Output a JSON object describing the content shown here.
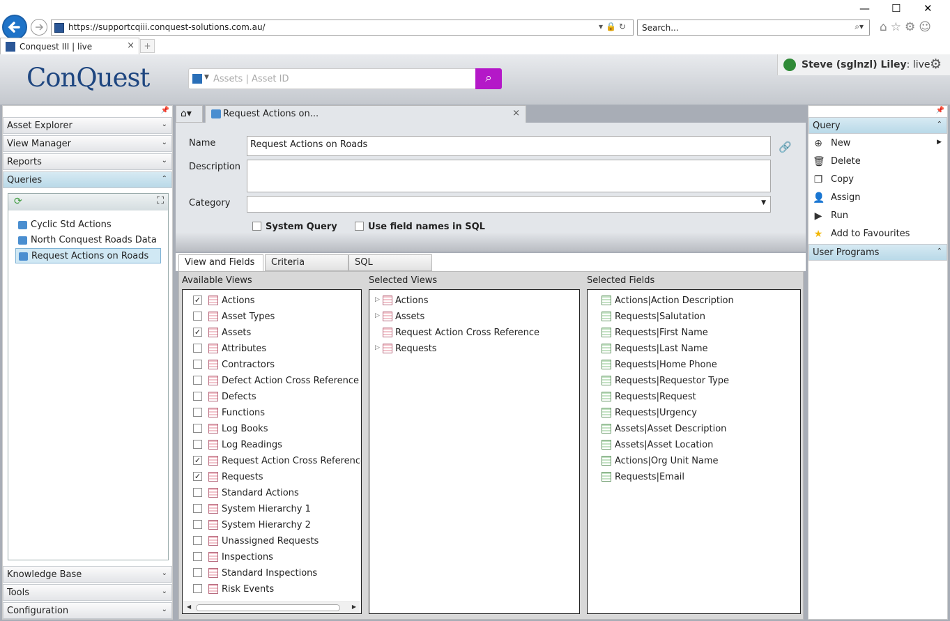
{
  "browser": {
    "url": "https://supportcqiii.conquest-solutions.com.au/",
    "search_placeholder": "Search...",
    "tab_title": "Conquest III | live"
  },
  "app": {
    "logo_text": "ConQuest",
    "search": {
      "scope": "Assets",
      "placeholder": "Assets  |  Asset ID"
    },
    "user": {
      "name": "Steve (sglnzl) Liley",
      "env": ": live"
    }
  },
  "left_panel": {
    "sections_top": [
      "Asset Explorer",
      "View Manager",
      "Reports",
      "Queries"
    ],
    "queries": [
      "Cyclic Std Actions",
      "North Conquest Roads Data",
      "Request Actions on Roads"
    ],
    "selected_query": "Request Actions on Roads",
    "sections_bottom": [
      "Knowledge Base",
      "Tools",
      "Configuration"
    ]
  },
  "main": {
    "doc_tab": "Request Actions on...",
    "form": {
      "name_label": "Name",
      "name_value": "Request Actions on Roads",
      "description_label": "Description",
      "description_value": "",
      "category_label": "Category",
      "category_value": "",
      "system_query_label": "System Query",
      "use_field_names_label": "Use field names in SQL"
    },
    "tabs": [
      "View and Fields",
      "Criteria",
      "SQL"
    ],
    "available_views_title": "Available Views",
    "available_views": [
      {
        "name": "Actions",
        "checked": true
      },
      {
        "name": "Asset Types",
        "checked": false
      },
      {
        "name": "Assets",
        "checked": true
      },
      {
        "name": "Attributes",
        "checked": false
      },
      {
        "name": "Contractors",
        "checked": false
      },
      {
        "name": "Defect Action Cross Reference",
        "checked": false
      },
      {
        "name": "Defects",
        "checked": false
      },
      {
        "name": "Functions",
        "checked": false
      },
      {
        "name": "Log Books",
        "checked": false
      },
      {
        "name": "Log Readings",
        "checked": false
      },
      {
        "name": "Request Action Cross Reference",
        "checked": true
      },
      {
        "name": "Requests",
        "checked": true
      },
      {
        "name": "Standard Actions",
        "checked": false
      },
      {
        "name": "System Hierarchy 1",
        "checked": false
      },
      {
        "name": "System Hierarchy 2",
        "checked": false
      },
      {
        "name": "Unassigned Requests",
        "checked": false
      },
      {
        "name": "Inspections",
        "checked": false
      },
      {
        "name": "Standard Inspections",
        "checked": false
      },
      {
        "name": "Risk Events",
        "checked": false
      }
    ],
    "selected_views_title": "Selected Views",
    "selected_views": [
      {
        "name": "Actions",
        "expandable": true
      },
      {
        "name": "Assets",
        "expandable": true
      },
      {
        "name": "Request Action Cross Reference",
        "expandable": false
      },
      {
        "name": "Requests",
        "expandable": true
      }
    ],
    "selected_fields_title": "Selected Fields",
    "selected_fields": [
      "Actions|Action Description",
      "Requests|Salutation",
      "Requests|First Name",
      "Requests|Last Name",
      "Requests|Home Phone",
      "Requests|Requestor Type",
      "Requests|Request",
      "Requests|Urgency",
      "Assets|Asset Description",
      "Assets|Asset Location",
      "Actions|Org Unit Name",
      "Requests|Email"
    ]
  },
  "right_panel": {
    "query_section": "Query",
    "actions": [
      {
        "label": "New",
        "icon": "plus-circle-icon",
        "glyph": "⊕",
        "submenu": true
      },
      {
        "label": "Delete",
        "icon": "trash-icon",
        "glyph": "🗑",
        "submenu": false
      },
      {
        "label": "Copy",
        "icon": "copy-icon",
        "glyph": "❐",
        "submenu": false
      },
      {
        "label": "Assign",
        "icon": "user-assign-icon",
        "glyph": "👤",
        "submenu": false
      },
      {
        "label": "Run",
        "icon": "run-icon",
        "glyph": "▶",
        "submenu": false
      },
      {
        "label": "Add to Favourites",
        "icon": "star-icon",
        "glyph": "★",
        "submenu": false
      }
    ],
    "user_programs_section": "User Programs"
  },
  "colors": {
    "accent": "#b418c8",
    "brand": "#1e4680",
    "check_red": "#d2232a",
    "star": "#f2b705"
  }
}
